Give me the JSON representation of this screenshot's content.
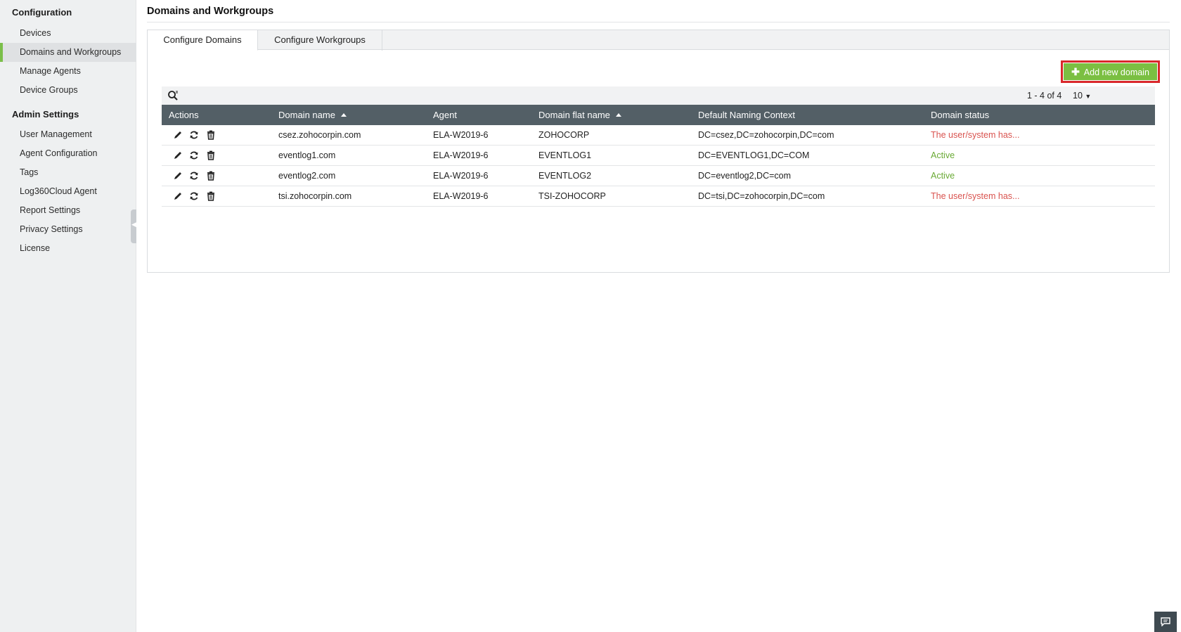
{
  "sidebar": {
    "sections": [
      {
        "title": "Configuration",
        "items": [
          "Devices",
          "Domains and Workgroups",
          "Manage Agents",
          "Device Groups"
        ]
      },
      {
        "title": "Admin Settings",
        "items": [
          "User Management",
          "Agent Configuration",
          "Tags",
          "Log360Cloud Agent",
          "Report Settings",
          "Privacy Settings",
          "License"
        ]
      }
    ],
    "active_item": "Domains and Workgroups"
  },
  "page": {
    "title": "Domains and Workgroups"
  },
  "tabs": [
    {
      "label": "Configure Domains",
      "active": true
    },
    {
      "label": "Configure Workgroups",
      "active": false
    }
  ],
  "toolbar": {
    "add_label": "Add new domain",
    "pager": "1 - 4 of 4",
    "page_size": "10"
  },
  "table": {
    "columns": [
      "Actions",
      "Domain name",
      "Agent",
      "Domain flat name",
      "Default Naming Context",
      "Domain status"
    ],
    "rows": [
      {
        "domain": "csez.zohocorpin.com",
        "agent": "ELA-W2019-6",
        "flat": "ZOHOCORP",
        "context": "DC=csez,DC=zohocorpin,DC=com",
        "status": "The user/system has...",
        "status_type": "error"
      },
      {
        "domain": "eventlog1.com",
        "agent": "ELA-W2019-6",
        "flat": "EVENTLOG1",
        "context": "DC=EVENTLOG1,DC=COM",
        "status": "Active",
        "status_type": "ok"
      },
      {
        "domain": "eventlog2.com",
        "agent": "ELA-W2019-6",
        "flat": "EVENTLOG2",
        "context": "DC=eventlog2,DC=com",
        "status": "Active",
        "status_type": "ok"
      },
      {
        "domain": "tsi.zohocorpin.com",
        "agent": "ELA-W2019-6",
        "flat": "TSI-ZOHOCORP",
        "context": "DC=tsi,DC=zohocorpin,DC=com",
        "status": "The user/system has...",
        "status_type": "error"
      }
    ]
  },
  "colors": {
    "accent_green": "#7bbf42",
    "header_bg": "#535f66",
    "highlight_red": "#d9282b",
    "status_error": "#d9534f",
    "status_ok": "#6aaa35"
  }
}
